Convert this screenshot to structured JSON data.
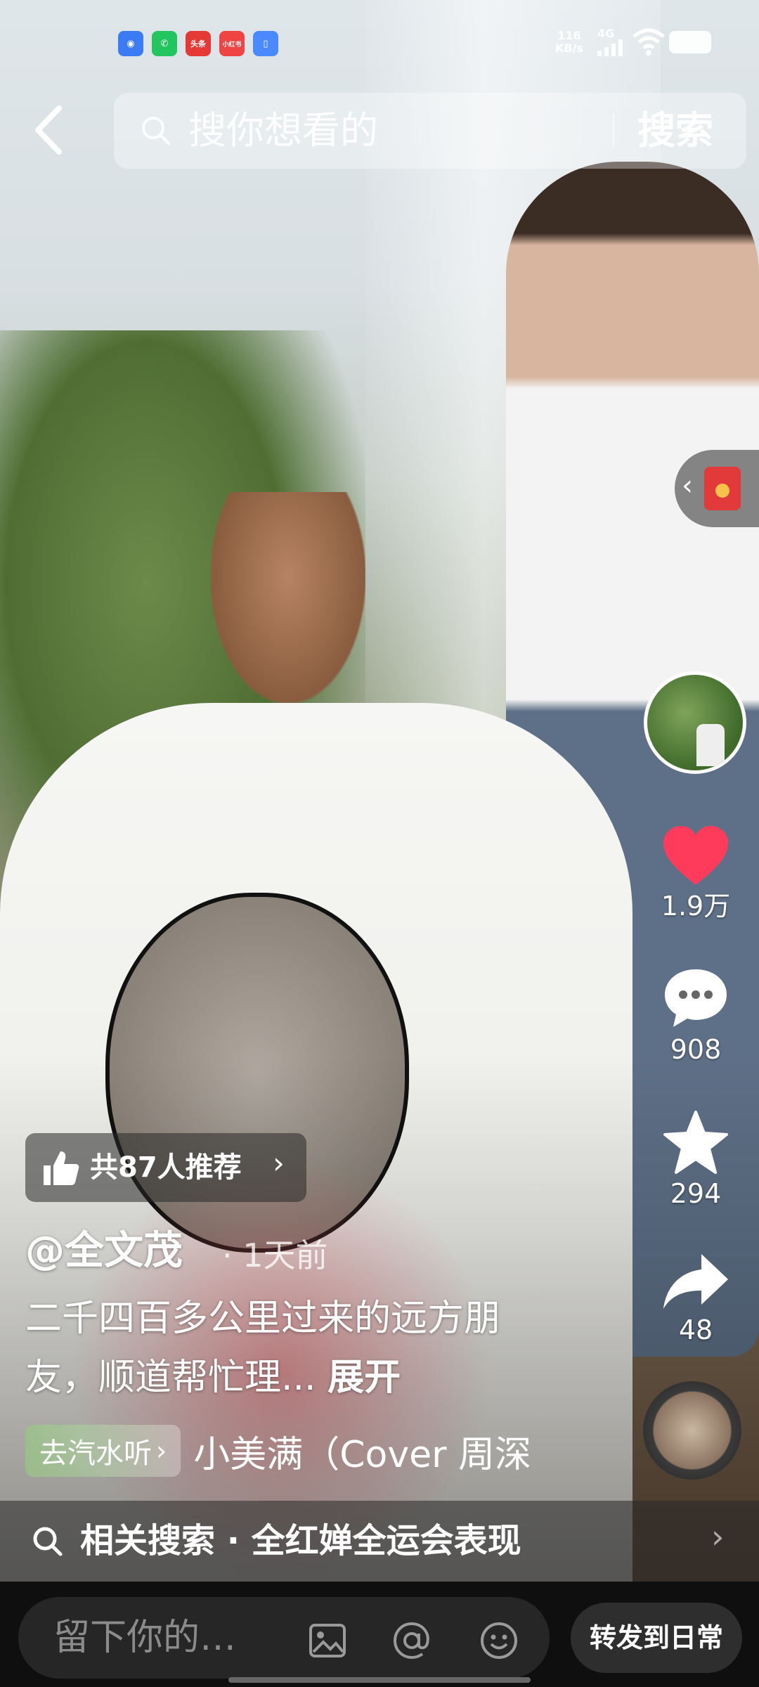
{
  "status_bar": {
    "app_icons": [
      {
        "name": "browser-app-icon",
        "color": "#3b7cf5",
        "label": ""
      },
      {
        "name": "phone-app-icon",
        "color": "#22c55e",
        "label": ""
      },
      {
        "name": "toutiao-app-icon",
        "color": "#e53935",
        "label": "头条"
      },
      {
        "name": "xiaohongshu-app-icon",
        "color": "#ef4444",
        "label": "小红书"
      },
      {
        "name": "files-app-icon",
        "color": "#4a89ff",
        "label": ""
      }
    ],
    "net_speed_value": "116",
    "net_speed_unit": "KB/s",
    "network": "4G"
  },
  "search": {
    "placeholder": "搜你想看的",
    "button_label": "搜索"
  },
  "rail": {
    "likes": "1.9万",
    "comments": "908",
    "favorites": "294",
    "shares": "48",
    "like_color": "#ff3b5c"
  },
  "video_info": {
    "recommend_text": "共87人推荐",
    "author": "@全文茂",
    "time": "· 1天前",
    "description": "二千四百多公里过来的远方朋友，顺道帮忙理...",
    "expand_label": "展开",
    "music_tag": "去汽水听",
    "music_title": "小美满（Cover 周深"
  },
  "related": {
    "text": "相关搜索 · 全红婵全运会表现"
  },
  "bottom_bar": {
    "comment_placeholder": "留下你的…",
    "share_daily_label": "转发到日常"
  }
}
